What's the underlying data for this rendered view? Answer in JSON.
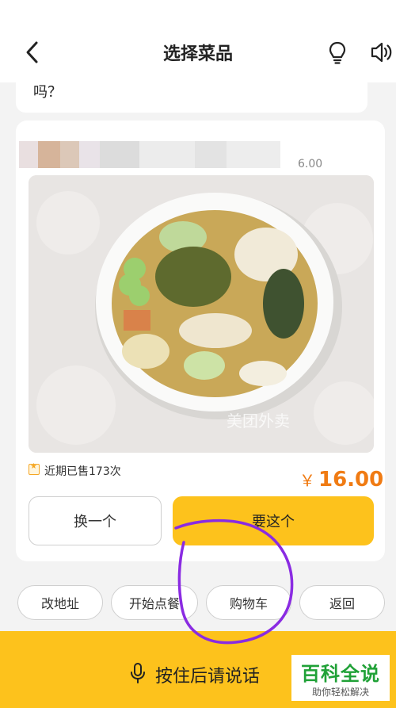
{
  "header": {
    "title": "选择菜品"
  },
  "previous_message": {
    "text": "吗？"
  },
  "dish": {
    "price_snippet": "6.00",
    "photo_watermark": "美团外卖",
    "sales_text": "近期已售173次",
    "currency_symbol": "￥",
    "price": "16.00"
  },
  "actions": {
    "change_label": "换一个",
    "want_label": "要这个"
  },
  "chips": [
    {
      "label": "改地址"
    },
    {
      "label": "开始点餐"
    },
    {
      "label": "购物车"
    },
    {
      "label": "返回"
    }
  ],
  "voice_bar": {
    "hold_label": "按住后请说话"
  },
  "baike_logo": {
    "main": "百科全说",
    "sub": "助你轻松解决"
  },
  "colors": {
    "accent_yellow": "#fdc21c",
    "price_orange": "#f07b13",
    "annotation_purple": "#8a2be2",
    "baike_green": "#20a137"
  }
}
